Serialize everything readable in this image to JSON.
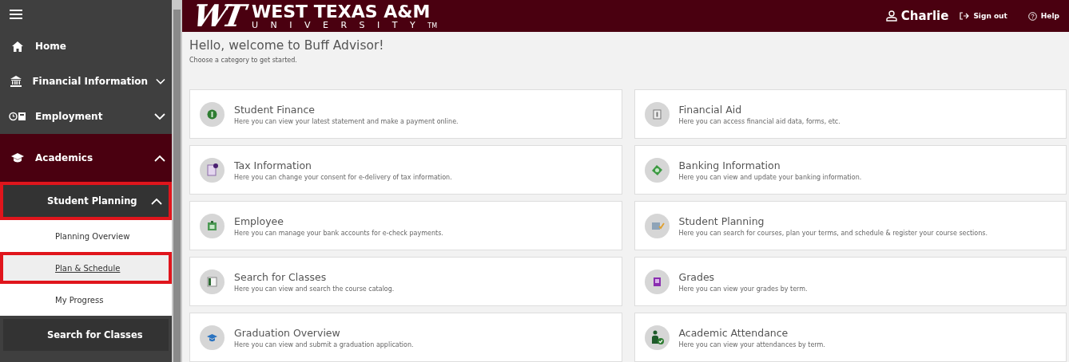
{
  "sidebar": {
    "items": [
      {
        "kind": "home",
        "label": "Home",
        "selected": false
      },
      {
        "kind": "bank",
        "label": "Financial Information",
        "expanded": false,
        "selected": false
      },
      {
        "kind": "employment",
        "label": "Employment",
        "expanded": false,
        "selected": false
      },
      {
        "kind": "academics",
        "label": "Academics",
        "expanded": true,
        "selected": true,
        "children": [
          {
            "label": "Student Planning",
            "expanded": true,
            "annotated": true,
            "children": [
              {
                "label": "Planning Overview",
                "selected": false,
                "annotated": false
              },
              {
                "label": "Plan & Schedule",
                "selected": true,
                "annotated": true
              },
              {
                "label": "My Progress",
                "selected": false,
                "annotated": false
              }
            ]
          },
          {
            "label": "Search for Classes",
            "annotated": false
          }
        ]
      }
    ]
  },
  "header": {
    "logo_mark": "WT",
    "logo_title": "WEST TEXAS A&M",
    "logo_subtitle": "UNIVERSITY",
    "logo_tm": "TM",
    "user": "Charlie",
    "sign_out": "Sign out",
    "help": "Help"
  },
  "welcome": {
    "title": "Hello, welcome to Buff Advisor!",
    "subtitle": "Choose a category to get started."
  },
  "cards": [
    {
      "kind": "finance",
      "title": "Student Finance",
      "description": "Here you can view your latest statement and make a payment online."
    },
    {
      "kind": "aid",
      "title": "Financial Aid",
      "description": "Here you can access financial aid data, forms, etc."
    },
    {
      "kind": "tax",
      "title": "Tax Information",
      "description": "Here you can change your consent for e-delivery of tax information."
    },
    {
      "kind": "banking",
      "title": "Banking Information",
      "description": "Here you can view and update your banking information."
    },
    {
      "kind": "employee",
      "title": "Employee",
      "description": "Here you can manage your bank accounts for e-check payments."
    },
    {
      "kind": "planning",
      "title": "Student Planning",
      "description": "Here you can search for courses, plan your terms, and schedule & register your course sections."
    },
    {
      "kind": "classes",
      "title": "Search for Classes",
      "description": "Here you can view and search the course catalog."
    },
    {
      "kind": "grades",
      "title": "Grades",
      "description": "Here you can view your grades by term."
    },
    {
      "kind": "graduation",
      "title": "Graduation Overview",
      "description": "Here you can view and submit a graduation application."
    },
    {
      "kind": "attendance",
      "title": "Academic Attendance",
      "description": "Here you can view your attendances by term."
    }
  ]
}
